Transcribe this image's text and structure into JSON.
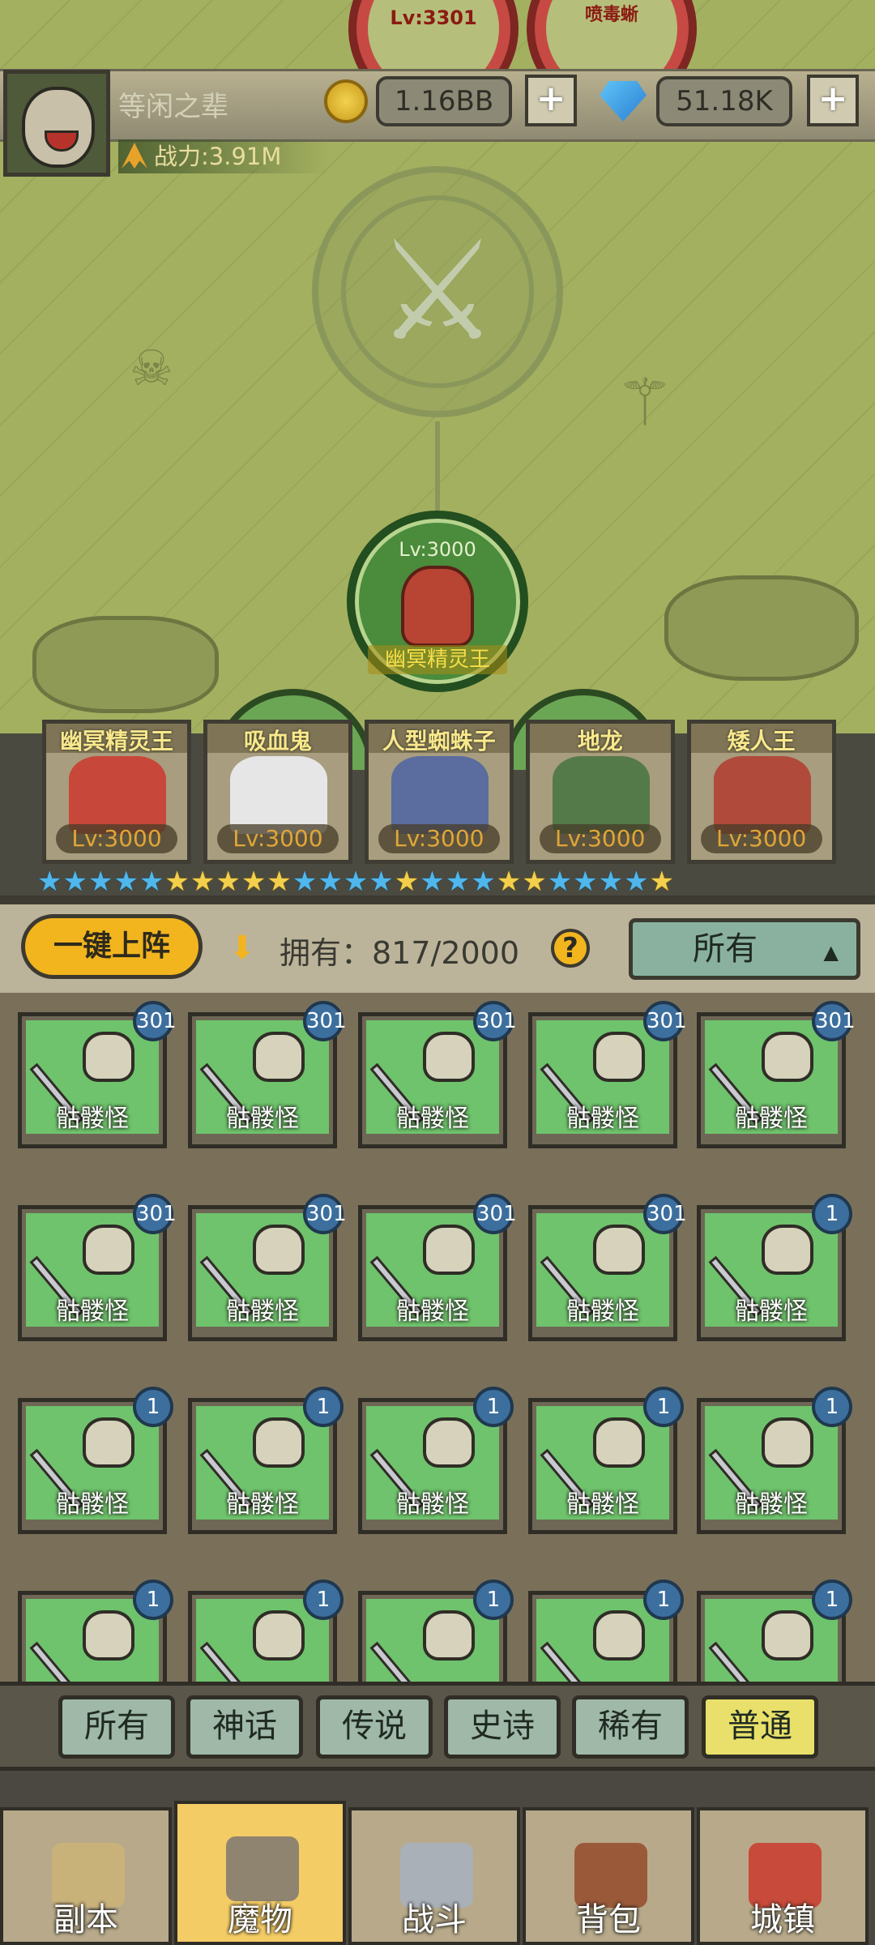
{
  "top_enemies": [
    {
      "level": "Lv:3301",
      "name": ""
    },
    {
      "level": "",
      "name": "喷毒蜥"
    }
  ],
  "header": {
    "username": "等闲之辈",
    "gold": "1.16BB",
    "gems": "51.18K",
    "plus": "+",
    "power": "战力:3.91M"
  },
  "boss": {
    "level": "Lv:3000",
    "name": "幽冥精灵王"
  },
  "team": [
    {
      "name": "幽冥精灵王",
      "level": "Lv:3000",
      "color": "#c7483a"
    },
    {
      "name": "吸血鬼",
      "level": "Lv:3000",
      "color": "#e6e6e6"
    },
    {
      "name": "人型蜘蛛子",
      "level": "Lv:3000",
      "color": "#5b6d9e"
    },
    {
      "name": "地龙",
      "level": "Lv:3000",
      "color": "#557a4a"
    },
    {
      "name": "矮人王",
      "level": "Lv:3000",
      "color": "#b04a3b"
    }
  ],
  "stars": [
    "b",
    "b",
    "b",
    "b",
    "b",
    "y",
    "y",
    "y",
    "y",
    "y",
    "b",
    "b",
    "b",
    "b",
    "y",
    "b",
    "b",
    "b",
    "y",
    "y",
    "b",
    "b",
    "b",
    "b",
    "y"
  ],
  "controls": {
    "one_click": "一键上阵",
    "owned": "拥有：817/2000",
    "help": "?",
    "filter": "所有",
    "filter_caret": "▲"
  },
  "monsters": [
    {
      "name": "骷髅怪",
      "count": "301"
    },
    {
      "name": "骷髅怪",
      "count": "301"
    },
    {
      "name": "骷髅怪",
      "count": "301"
    },
    {
      "name": "骷髅怪",
      "count": "301"
    },
    {
      "name": "骷髅怪",
      "count": "301"
    },
    {
      "name": "骷髅怪",
      "count": "301"
    },
    {
      "name": "骷髅怪",
      "count": "301"
    },
    {
      "name": "骷髅怪",
      "count": "301"
    },
    {
      "name": "骷髅怪",
      "count": "301"
    },
    {
      "name": "骷髅怪",
      "count": "1"
    },
    {
      "name": "骷髅怪",
      "count": "1"
    },
    {
      "name": "骷髅怪",
      "count": "1"
    },
    {
      "name": "骷髅怪",
      "count": "1"
    },
    {
      "name": "骷髅怪",
      "count": "1"
    },
    {
      "name": "骷髅怪",
      "count": "1"
    },
    {
      "name": "",
      "count": "1"
    },
    {
      "name": "",
      "count": "1"
    },
    {
      "name": "",
      "count": "1"
    },
    {
      "name": "",
      "count": "1"
    },
    {
      "name": "",
      "count": "1"
    }
  ],
  "rarity_tabs": [
    "所有",
    "神话",
    "传说",
    "史诗",
    "稀有",
    "普通"
  ],
  "active_rarity": 5,
  "nav": [
    {
      "label": "副本",
      "icon": "map-icon",
      "color": "#c9b27a"
    },
    {
      "label": "魔物",
      "icon": "helmet-icon",
      "color": "#8f8470"
    },
    {
      "label": "战斗",
      "icon": "crossed-swords-icon",
      "color": "#a9b0b8"
    },
    {
      "label": "背包",
      "icon": "backpack-icon",
      "color": "#9a5a3a"
    },
    {
      "label": "城镇",
      "icon": "town-icon",
      "color": "#c84a3a"
    }
  ],
  "active_nav": 1
}
